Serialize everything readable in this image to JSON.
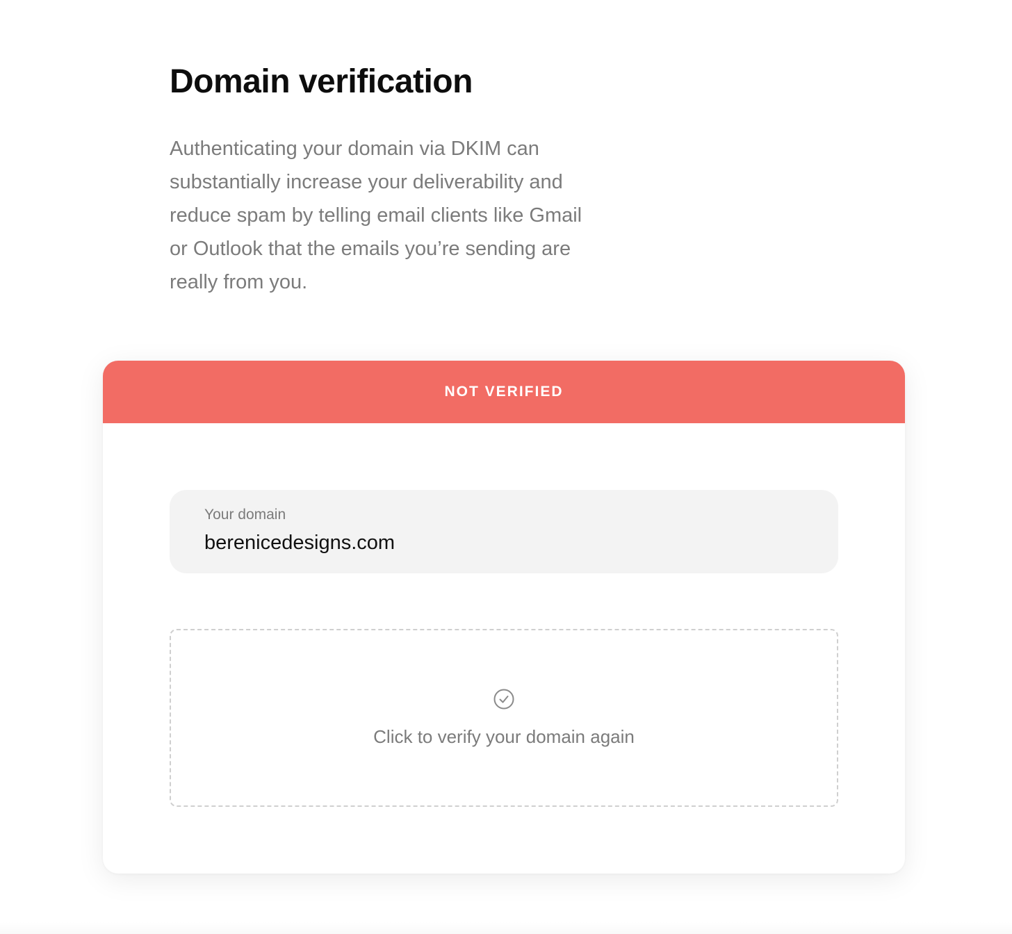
{
  "header": {
    "title": "Domain verification",
    "description": "Authenticating your domain via DKIM can substantially increase your deliverability and reduce spam by telling email clients like Gmail or Outlook that the emails you’re sending are really from you."
  },
  "card": {
    "status": {
      "label": "NOT VERIFIED",
      "color": "#f26c64"
    },
    "domain_field": {
      "label": "Your domain",
      "value": "berenicedesigns.com"
    },
    "verify_action": {
      "icon": "check-circle-icon",
      "label": "Click to verify your domain again"
    }
  },
  "colors": {
    "background": "#ffffff",
    "title_text": "#0d0d0d",
    "muted_text": "#7b7b7b",
    "field_background": "#f3f3f3",
    "dashed_border": "#cfcfcf"
  }
}
